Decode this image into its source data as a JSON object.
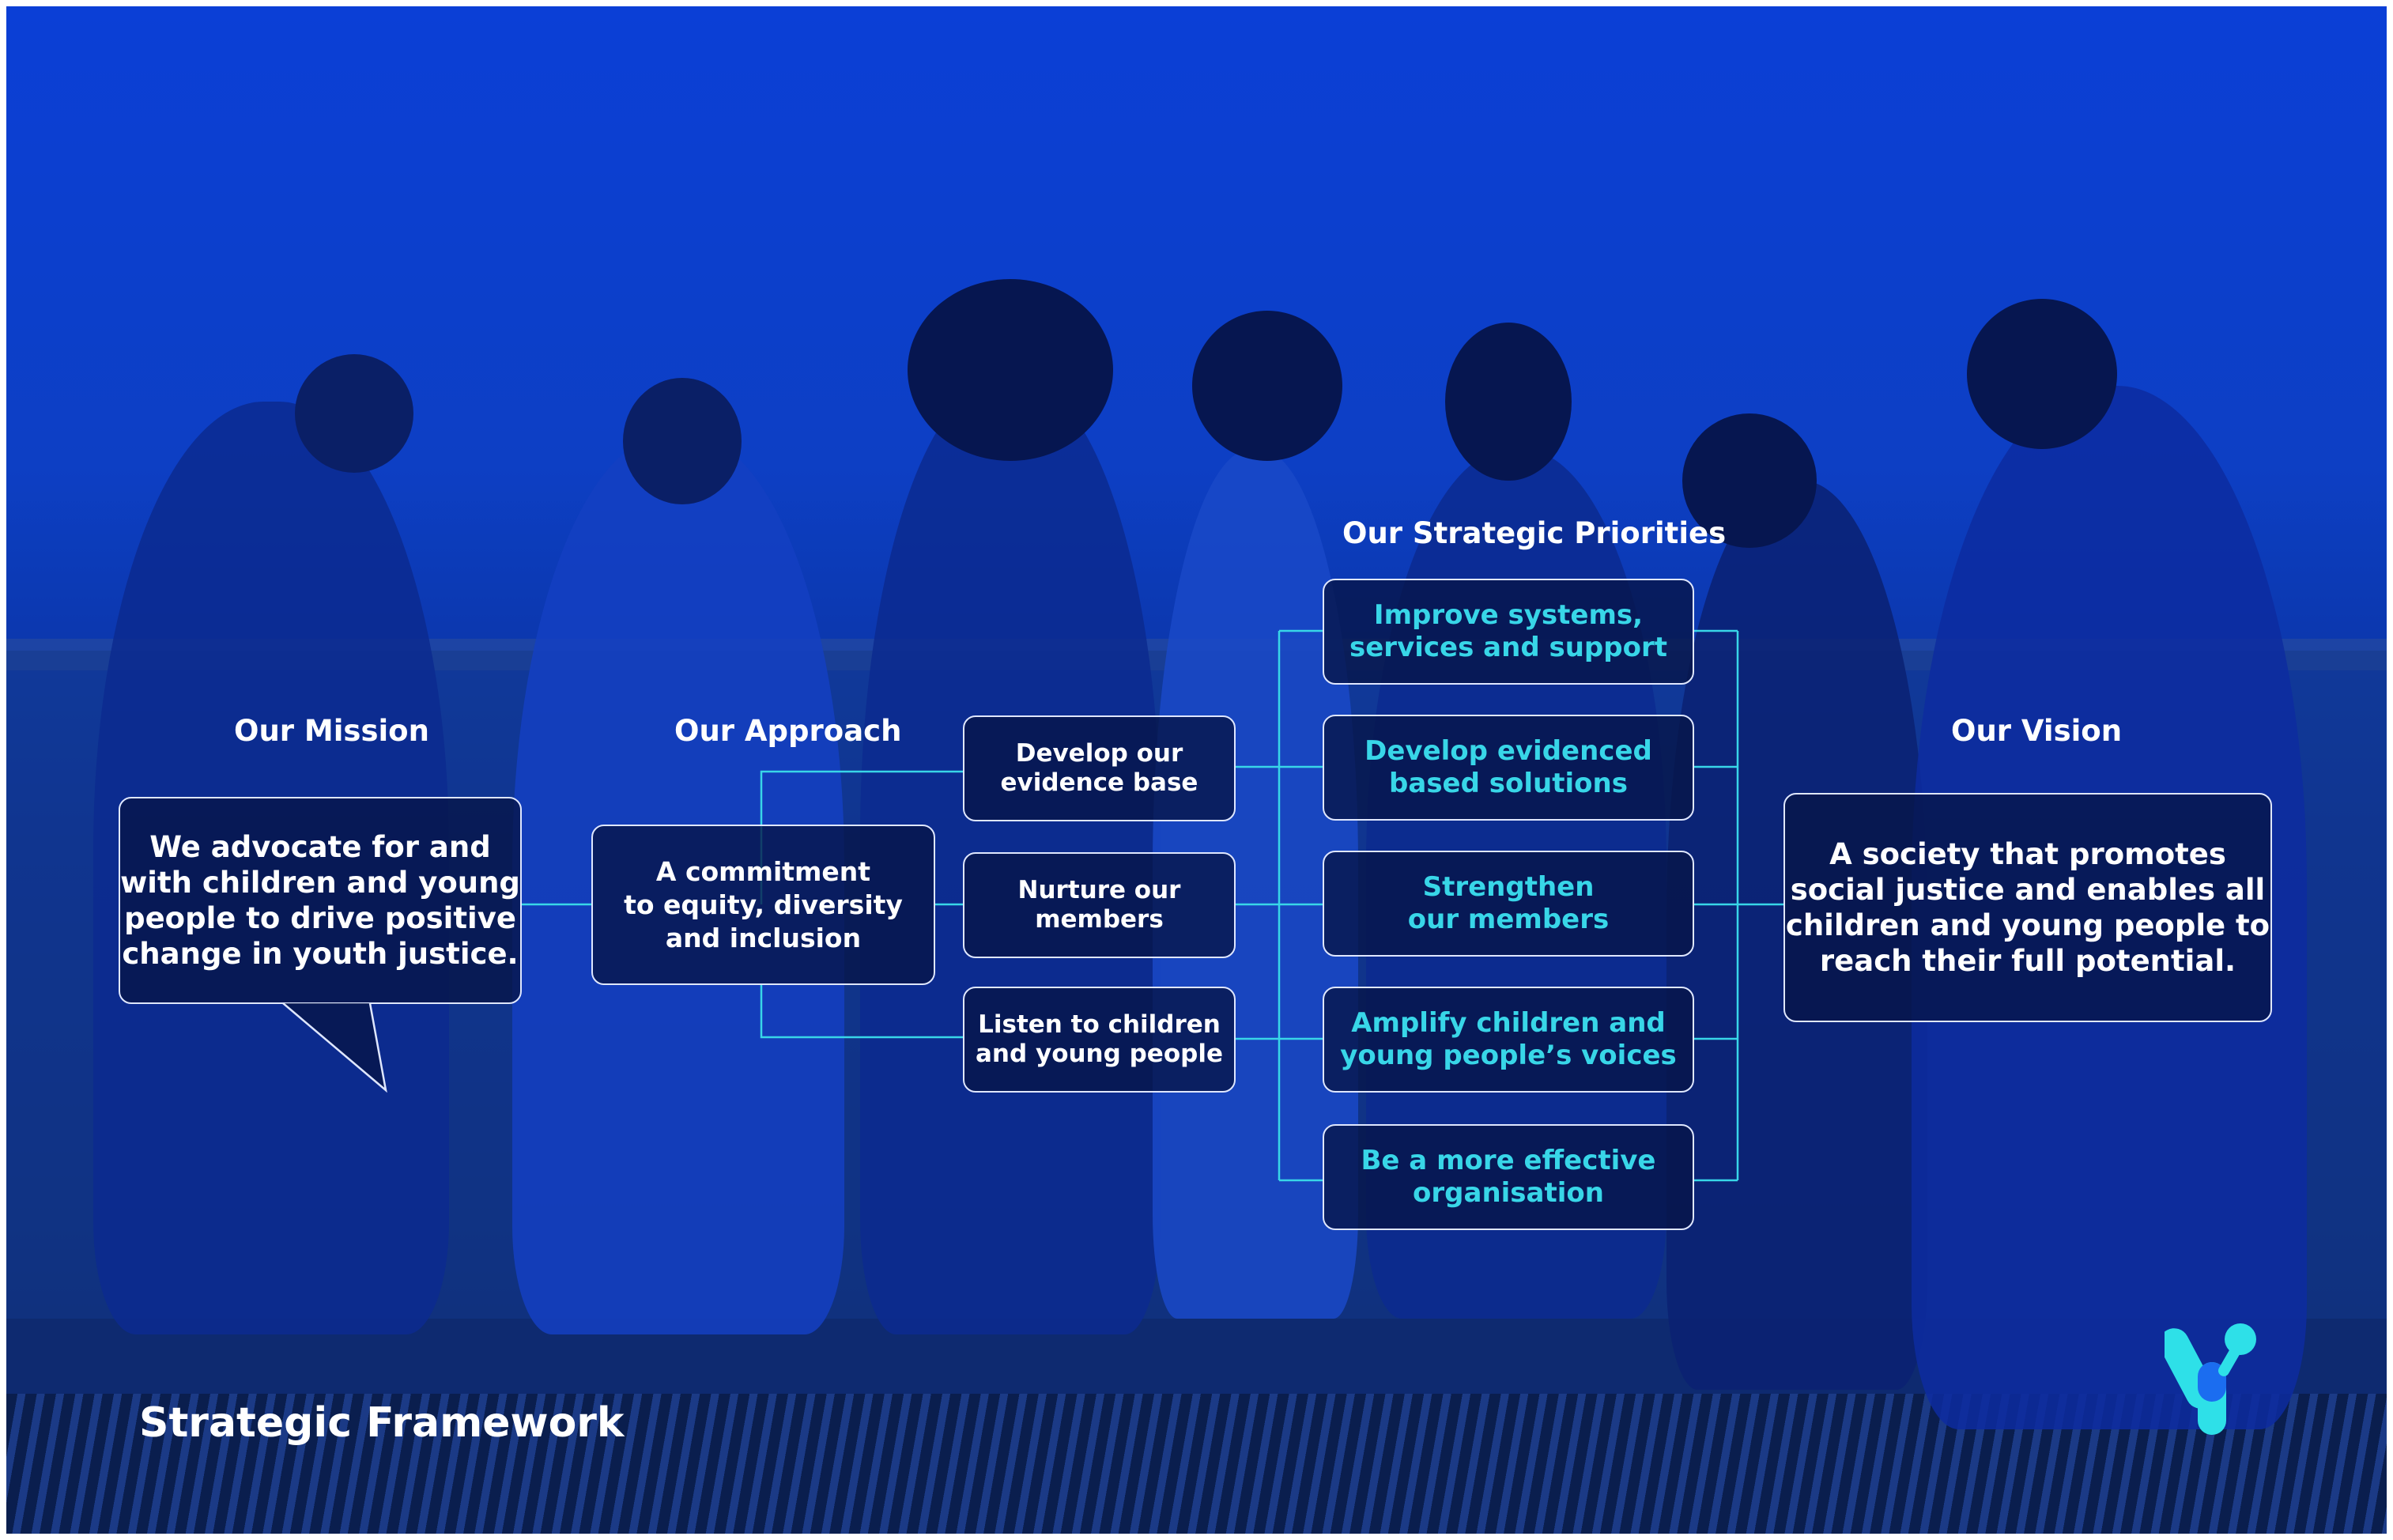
{
  "colors": {
    "background_blue": "#0b3fd6",
    "accent_cyan": "#38d6e8",
    "box_border": "#dfe7ff",
    "text_white": "#ffffff"
  },
  "mission": {
    "heading": "Our Mission",
    "lines": [
      "We advocate for and",
      "with children and young",
      "people to drive positive",
      "change in youth justice."
    ]
  },
  "approach": {
    "heading": "Our Approach",
    "lines": [
      "A commitment",
      "to equity, diversity",
      "and inclusion"
    ],
    "items": [
      {
        "lines": [
          "Develop our",
          "evidence base"
        ]
      },
      {
        "lines": [
          "Nurture our",
          "members"
        ]
      },
      {
        "lines": [
          "Listen to children",
          "and young people"
        ]
      }
    ]
  },
  "priorities": {
    "heading": "Our Strategic Priorities",
    "items": [
      {
        "lines": [
          "Improve systems,",
          "services and support"
        ]
      },
      {
        "lines": [
          "Develop evidenced",
          "based solutions"
        ]
      },
      {
        "lines": [
          "Strengthen",
          "our members"
        ]
      },
      {
        "lines": [
          "Amplify children and",
          "young people’s voices"
        ]
      },
      {
        "lines": [
          "Be a more effective",
          "organisation"
        ]
      }
    ]
  },
  "vision": {
    "heading": "Our Vision",
    "lines": [
      "A society that promotes",
      "social justice and enables all",
      "children and young people to",
      "reach their full potential."
    ]
  },
  "footer": {
    "title": "Strategic Framework"
  },
  "logo": {
    "icon": "y-logo-icon",
    "colors": [
      "#2ee0e8",
      "#1b6df0"
    ]
  }
}
